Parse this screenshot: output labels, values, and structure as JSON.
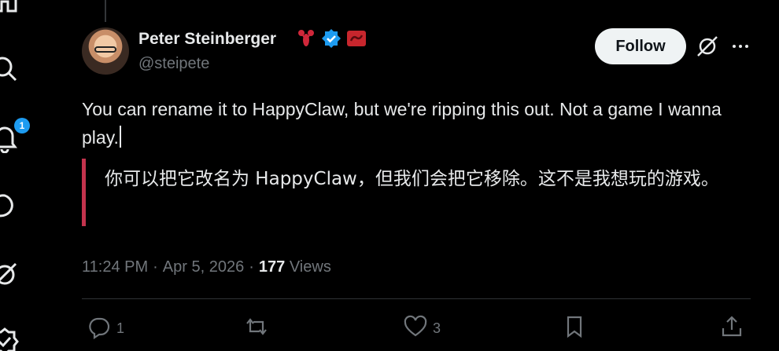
{
  "nav": {
    "icons": [
      "home-icon",
      "search-icon",
      "notifications-icon",
      "messages-icon",
      "grok-icon",
      "verified-icon"
    ],
    "notification_count": "1"
  },
  "tweet": {
    "author_name": "Peter Steinberger",
    "handle": "@steipete",
    "follow_label": "Follow",
    "text": "You can rename it to HappyClaw, but we're ripping this out. Not a game I wanna play.",
    "translation": "你可以把它改名为 HappyClaw，但我们会把它移除。这不是我想玩的游戏。",
    "time": "11:24 PM",
    "separator": "·",
    "date": "Apr 5, 2026",
    "views_count": "177",
    "views_label": "Views"
  },
  "actions": {
    "replies": "1",
    "reposts": "",
    "likes": "3"
  },
  "colors": {
    "background": "#000000",
    "text": "#e7e9ea",
    "muted": "#71767b",
    "accent": "#1d9bf0",
    "translation_border": "#c3334d"
  }
}
